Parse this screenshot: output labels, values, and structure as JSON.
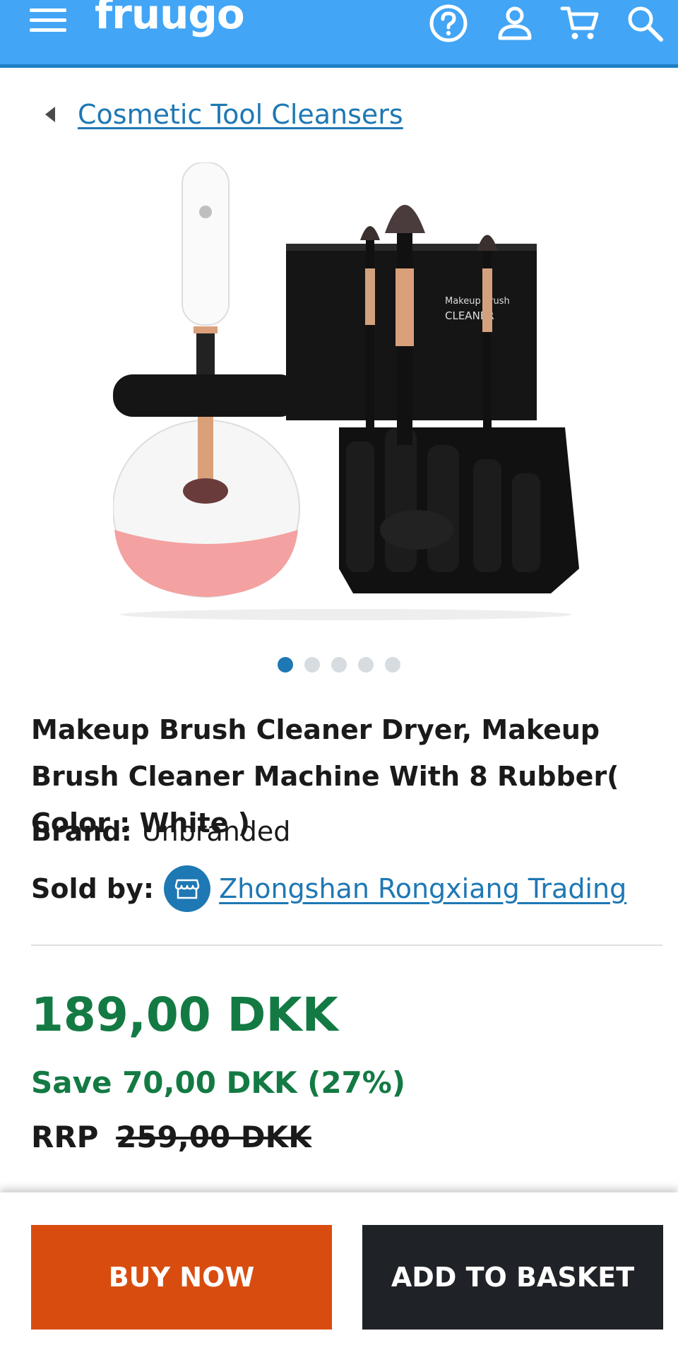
{
  "header": {
    "logo": "fruugo",
    "menu_icon": "hamburger-menu-icon",
    "help_icon": "help-icon",
    "account_icon": "account-icon",
    "cart_icon": "cart-icon",
    "search_icon": "search-icon",
    "bg_color": "#42a5f5"
  },
  "breadcrumb": {
    "label": "Cosmetic Tool Cleansers"
  },
  "gallery": {
    "image_alt": "Makeup brush cleaner machine with brushes and box",
    "dot_count": 5,
    "active_index": 0
  },
  "product": {
    "title": "Makeup Brush Cleaner Dryer, Makeup Brush Cleaner Machine With 8 Rubber( Color : White )",
    "brand_label": "Brand:",
    "brand_value": "Unbranded",
    "sold_by_label": "Sold by:",
    "seller_name": "Zhongshan Rongxiang Trading",
    "seller_icon": "store-icon"
  },
  "pricing": {
    "price": "189,00 DKK",
    "save": "Save 70,00 DKK (27%)",
    "rrp_label": "RRP",
    "rrp_value": "259,00 DKK",
    "price_color": "#137a43"
  },
  "actions": {
    "buy_now": "BUY NOW",
    "add_to_basket": "ADD TO BASKET",
    "buy_color": "#d84d0f",
    "basket_color": "#1f2227"
  }
}
